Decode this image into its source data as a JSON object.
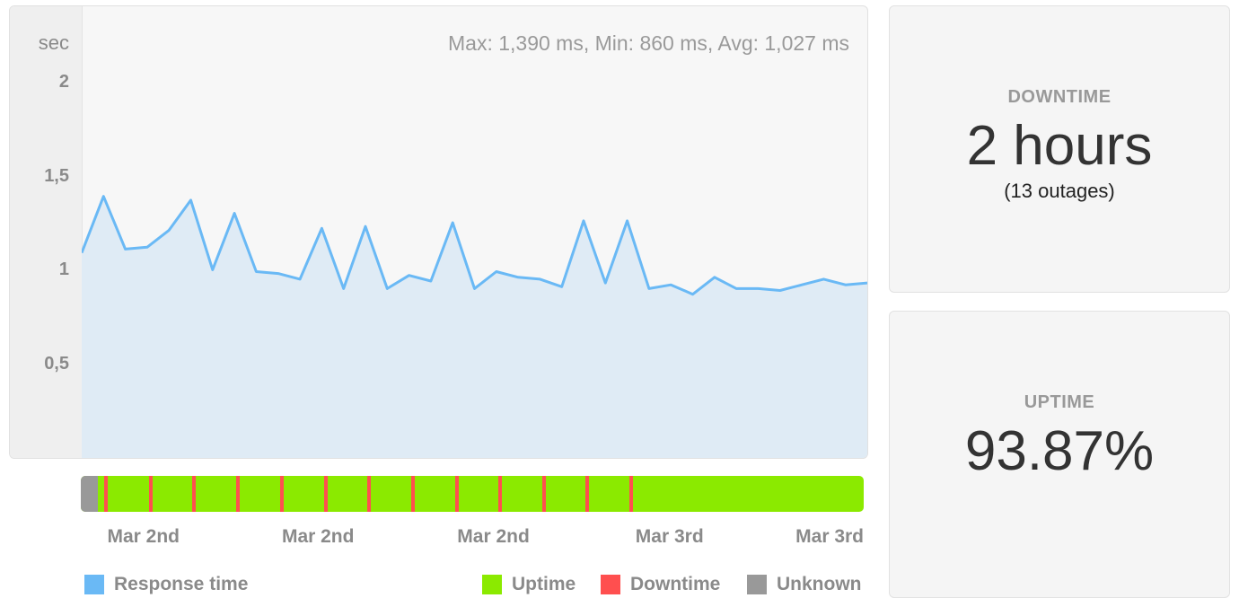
{
  "chart_data": {
    "type": "area",
    "y_unit": "sec",
    "stats_text": "Max: 1,390 ms, Min: 860 ms, Avg: 1,027 ms",
    "y_ticks": [
      "2",
      "1,5",
      "1",
      "0,5"
    ],
    "y_tick_values": [
      2,
      1.5,
      1,
      0.5
    ],
    "ylim": [
      0,
      2.4
    ],
    "x_tick_labels": [
      "Mar 2nd",
      "Mar 2nd",
      "Mar 2nd",
      "Mar 3rd",
      "Mar 3rd"
    ],
    "x_tick_positions": [
      0.08,
      0.303,
      0.527,
      0.752,
      0.988
    ],
    "series": [
      {
        "name": "Response time",
        "color": "#6ab9f5",
        "fill": "#dfebf5",
        "values": [
          1.09,
          1.39,
          1.11,
          1.12,
          1.21,
          1.37,
          1.0,
          1.3,
          0.99,
          0.98,
          0.95,
          1.22,
          0.9,
          1.23,
          0.9,
          0.97,
          0.94,
          1.25,
          0.9,
          0.99,
          0.96,
          0.95,
          0.91,
          1.26,
          0.93,
          1.26,
          0.9,
          0.92,
          0.87,
          0.96,
          0.9,
          0.9,
          0.89,
          0.92,
          0.95,
          0.92,
          0.93
        ]
      }
    ],
    "status": {
      "colors": {
        "uptime": "#8bea00",
        "downtime": "#ff4f4f",
        "unknown": "#999999"
      },
      "unknown_span": [
        0,
        0.022
      ],
      "downtime_marks": [
        0.032,
        0.09,
        0.145,
        0.201,
        0.257,
        0.313,
        0.368,
        0.424,
        0.48,
        0.536,
        0.592,
        0.647,
        0.703
      ]
    }
  },
  "legend": {
    "response_time": {
      "label": "Response time",
      "color": "#6ab9f5"
    },
    "uptime": {
      "label": "Uptime",
      "color": "#8bea00"
    },
    "downtime": {
      "label": "Downtime",
      "color": "#ff4f4f"
    },
    "unknown": {
      "label": "Unknown",
      "color": "#999999"
    }
  },
  "downtime_card": {
    "title": "DOWNTIME",
    "value": "2 hours",
    "sub": "(13 outages)"
  },
  "uptime_card": {
    "title": "UPTIME",
    "value": "93.87%"
  }
}
